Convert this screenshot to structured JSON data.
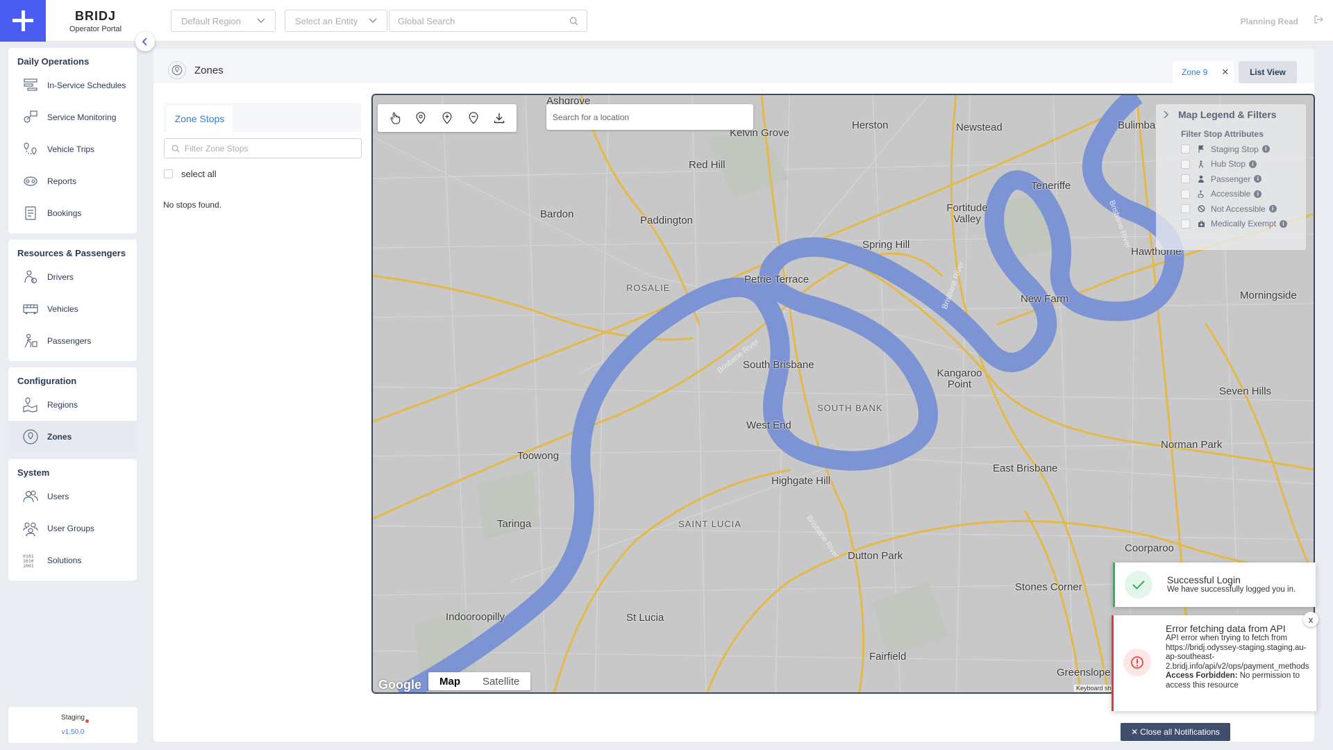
{
  "brand": {
    "name": "BRIDJ",
    "subtitle": "Operator Portal",
    "accent": "#4b5cf0"
  },
  "topbar": {
    "region_placeholder": "Default Region",
    "entity_placeholder": "Select an Entity",
    "search_placeholder": "Global Search",
    "user": "Planning Read"
  },
  "sidebar": {
    "groups": [
      {
        "title": "Daily Operations",
        "items": [
          "In-Service Schedules",
          "Service Monitoring",
          "Vehicle Trips",
          "Reports",
          "Bookings"
        ]
      },
      {
        "title": "Resources & Passengers",
        "items": [
          "Drivers",
          "Vehicles",
          "Passengers"
        ]
      },
      {
        "title": "Configuration",
        "items": [
          "Regions",
          "Zones"
        ]
      },
      {
        "title": "System",
        "items": [
          "Users",
          "User Groups",
          "Solutions"
        ]
      }
    ],
    "active_item": "Zones",
    "environment": "Staging",
    "version": "v1.50.0"
  },
  "page": {
    "title": "Zones",
    "tabs": {
      "zone_tab": "Zone 9",
      "list_view": "List View"
    }
  },
  "zone_stops": {
    "tab": "Zone Stops",
    "filter_placeholder": "Filter Zone Stops",
    "select_all": "select all",
    "empty_message": "No stops found."
  },
  "map": {
    "search_placeholder": "Search for a location",
    "map_type": {
      "map": "Map",
      "satellite": "Satellite"
    },
    "google": "Google",
    "attribution": "Keyboard sh",
    "labels": {
      "ashgrove": "Ashgrove",
      "kelvin_grove": "Kelvin Grove",
      "herston": "Herston",
      "newstead": "Newstead",
      "bulimba": "Bulimba",
      "red_hill": "Red Hill",
      "teneriffe": "Teneriffe",
      "bardon": "Bardon",
      "paddington": "Paddington",
      "fortitude_valley": "Fortitude Valley",
      "spring_hill": "Spring Hill",
      "hawthorne": "Hawthorne",
      "rosalie": "ROSALIE",
      "petrie_terrace": "Petrie Terrace",
      "new_farm": "New Farm",
      "morningside": "Morningside",
      "south_brisbane": "South Brisbane",
      "kangaroo_point": "Kangaroo Point",
      "south_bank": "SOUTH BANK",
      "seven_hills": "Seven Hills",
      "west_end": "West End",
      "norman_park": "Norman Park",
      "toowong": "Toowong",
      "east_brisbane": "East Brisbane",
      "highgate_hill": "Highgate Hill",
      "taringa": "Taringa",
      "saint_lucia_upper": "SAINT LUCIA",
      "coorparoo": "Coorparoo",
      "dutton_park": "Dutton Park",
      "stones_corner": "Stones Corner",
      "indooroopilly": "Indooroopilly",
      "st_lucia": "St Lucia",
      "fairfield": "Fairfield",
      "greenslopes": "Greenslope",
      "brisbane_river": "Brisbane River"
    }
  },
  "legend": {
    "title": "Map Legend & Filters",
    "subtitle": "Filter Stop Attributes",
    "items": [
      "Staging Stop",
      "Hub Stop",
      "Passenger",
      "Accessible",
      "Not Accessible",
      "Medically Exempt"
    ]
  },
  "notifications": {
    "success": {
      "title": "Successful Login",
      "message": "We have successfully logged you in.",
      "color": "#2fb45a"
    },
    "error": {
      "title": "Error fetching data from API",
      "message": "API error when trying to fetch from https://bridj.odyssey-staging.staging.au-ap-southeast-2.bridj.info/api/v2/ops/payment_methods",
      "forbidden_label": "Access Forbidden:",
      "forbidden_text": " No permission to access this resource",
      "color": "#e53935"
    },
    "close_x": "x",
    "close_all": "Close all Notifications"
  }
}
